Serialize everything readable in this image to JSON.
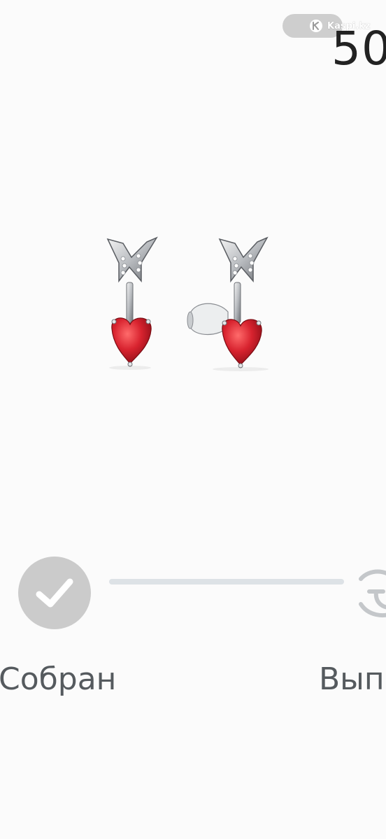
{
  "watermark": {
    "text": "Kaspi.kz",
    "icon": "kaspi-logo-icon"
  },
  "product": {
    "price_partial": "50",
    "image_description_icon": "heart-arrow-earrings-image"
  },
  "status_tracker": {
    "steps": [
      {
        "label": "Собран",
        "state": "completed",
        "icon": "check-icon"
      },
      {
        "label": "Выпо",
        "state": "pending",
        "icon": "refresh-icon"
      }
    ]
  },
  "colors": {
    "background": "#fbfbfb",
    "completed_circle": "#cbcbcb",
    "progress_line": "#dde2e6",
    "label_text": "#555a5e",
    "price_text": "#222222",
    "gem_red": "#d8232f"
  }
}
